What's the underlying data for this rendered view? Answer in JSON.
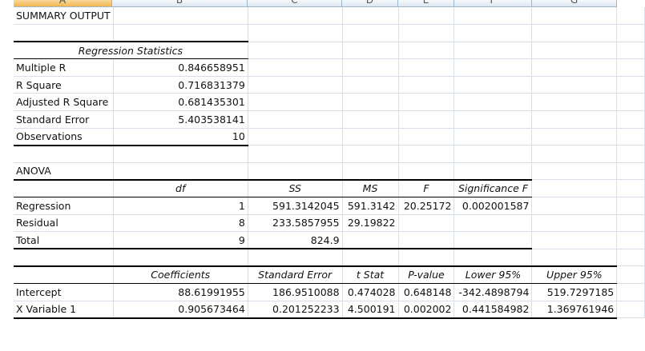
{
  "columns": [
    "A",
    "B",
    "C",
    "D",
    "E",
    "F",
    "G"
  ],
  "title": "SUMMARY OUTPUT",
  "regression_statistics": {
    "heading": "Regression Statistics",
    "rows": [
      {
        "label": "Multiple R",
        "value": "0.846658951"
      },
      {
        "label": "R Square",
        "value": "0.716831379"
      },
      {
        "label": "Adjusted R Square",
        "value": "0.681435301"
      },
      {
        "label": "Standard Error",
        "value": "5.403538141"
      },
      {
        "label": "Observations",
        "value": "10"
      }
    ]
  },
  "anova": {
    "heading": "ANOVA",
    "headers": [
      "df",
      "SS",
      "MS",
      "F",
      "Significance F"
    ],
    "rows": [
      {
        "label": "Regression",
        "df": "1",
        "ss": "591.3142045",
        "ms": "591.3142",
        "f": "20.25172",
        "sig": "0.002001587"
      },
      {
        "label": "Residual",
        "df": "8",
        "ss": "233.5857955",
        "ms": "29.19822"
      },
      {
        "label": "Total",
        "df": "9",
        "ss": "824.9"
      }
    ]
  },
  "coefficients": {
    "headers": [
      "Coefficients",
      "Standard Error",
      "t Stat",
      "P-value",
      "Lower 95%",
      "Upper 95%"
    ],
    "rows": [
      {
        "label": "Intercept",
        "values": [
          "88.61991955",
          "186.9510088",
          "0.474028",
          "0.648148",
          "-342.4898794",
          "519.7297185"
        ]
      },
      {
        "label": "X Variable 1",
        "values": [
          "0.905673464",
          "0.201252233",
          "4.500191",
          "0.002002",
          "0.441584982",
          "1.369761946"
        ]
      }
    ]
  }
}
